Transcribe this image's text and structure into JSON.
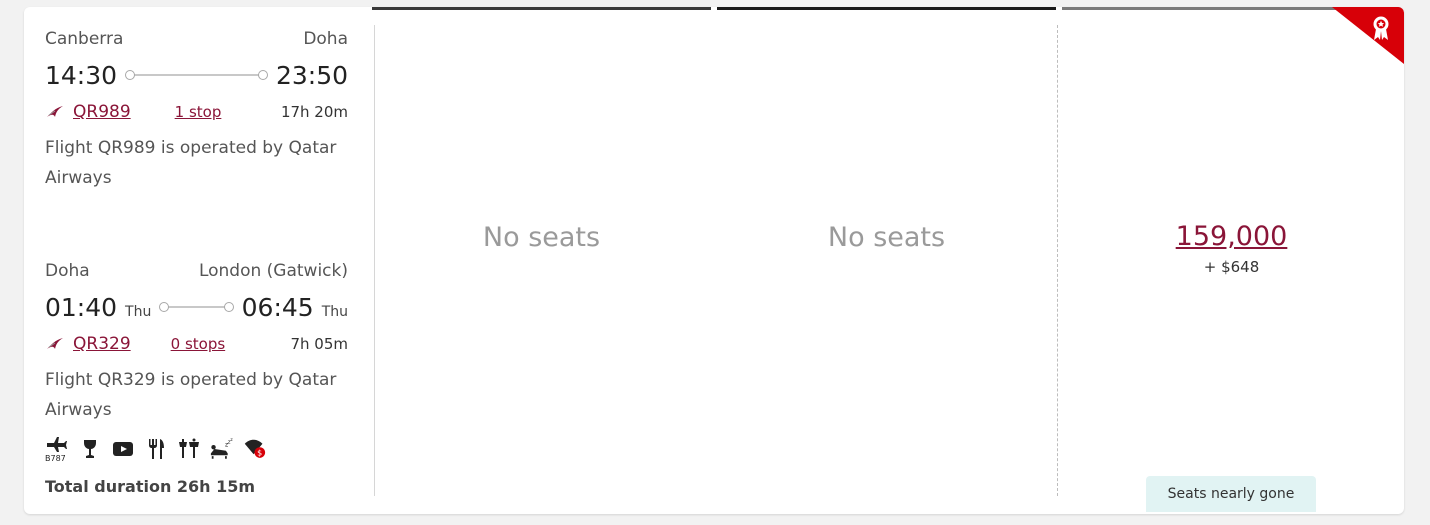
{
  "legs": [
    {
      "origin": "Canberra",
      "destination": "Doha",
      "depart_time": "14:30",
      "depart_day": "",
      "arrive_time": "23:50",
      "arrive_day": "",
      "flight_number": "QR989",
      "stops": "1 stop",
      "duration": "17h 20m",
      "operated_by": "Flight QR989 is operated by Qatar Airways"
    },
    {
      "origin": "Doha",
      "destination": "London (Gatwick)",
      "depart_time": "01:40",
      "depart_day": "Thu",
      "arrive_time": "06:45",
      "arrive_day": "Thu",
      "flight_number": "QR329",
      "stops": "0 stops",
      "duration": "7h 05m",
      "operated_by": "Flight QR329 is operated by Qatar Airways"
    }
  ],
  "amenities": {
    "aircraft_label": "B787",
    "icons": [
      "aircraft-icon",
      "drinks-icon",
      "entertainment-icon",
      "meal-icon",
      "restaurant-icon",
      "flat-bed-icon",
      "wifi-paid-icon"
    ]
  },
  "total_duration": "Total duration 26h 15m",
  "cabins": {
    "col1": "No seats",
    "col2": "No seats",
    "col3": {
      "points": "159,000",
      "tax": "+ $648",
      "availability": "Seats nearly gone"
    }
  },
  "colors": {
    "accent": "#8a1538",
    "corner_badge": "#d70008",
    "availability_bg": "#e1f3f3"
  }
}
